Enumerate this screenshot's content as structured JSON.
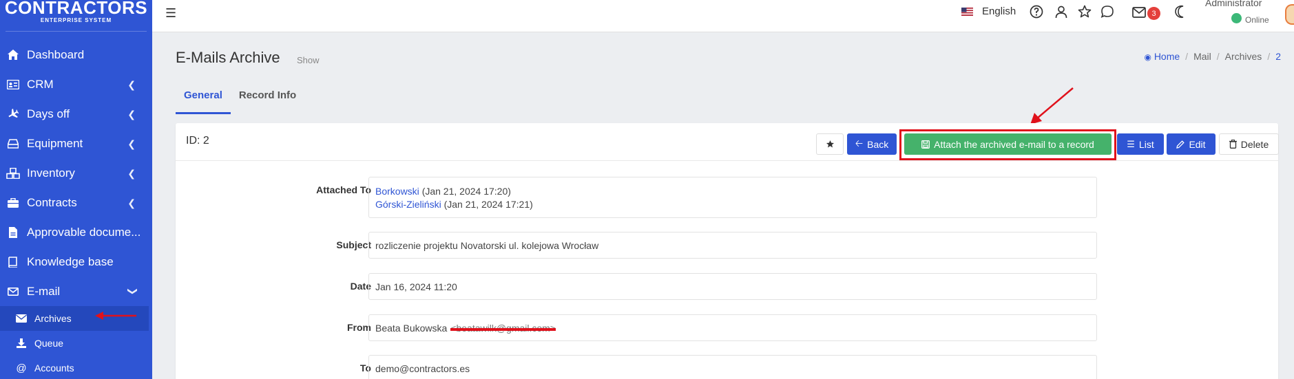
{
  "app": {
    "logo_title": "CONTRACTORS",
    "logo_sub": "ENTERPRISE SYSTEM"
  },
  "sidebar": {
    "items": [
      {
        "label": "Dashboard",
        "icon": "home-icon"
      },
      {
        "label": "CRM",
        "icon": "id-card-icon"
      },
      {
        "label": "Days off",
        "icon": "plane-icon"
      },
      {
        "label": "Equipment",
        "icon": "hdd-icon"
      },
      {
        "label": "Inventory",
        "icon": "boxes-icon"
      },
      {
        "label": "Contracts",
        "icon": "briefcase-icon"
      },
      {
        "label": "Approvable docume...",
        "icon": "file-icon"
      },
      {
        "label": "Knowledge base",
        "icon": "book-icon"
      },
      {
        "label": "E-mail",
        "icon": "envelope-icon"
      }
    ],
    "email_sub": [
      {
        "label": "Archives",
        "icon": "envelope-icon"
      },
      {
        "label": "Queue",
        "icon": "download-icon"
      },
      {
        "label": "Accounts",
        "icon": "at-icon"
      }
    ]
  },
  "topbar": {
    "language": "English",
    "mail_count": "3",
    "user_name": "Administrator",
    "status": "Online"
  },
  "page": {
    "title": "E-Mails Archive",
    "subtitle": "Show",
    "breadcrumb": [
      "Home",
      "Mail",
      "Archives",
      "2"
    ]
  },
  "tabs": [
    "General",
    "Record Info"
  ],
  "card": {
    "id_label": "ID: 2",
    "buttons": {
      "back": "Back",
      "attach": "Attach the archived e-mail to a record",
      "list": "List",
      "edit": "Edit",
      "delete": "Delete"
    }
  },
  "fields": {
    "attached_to_label": "Attached To",
    "attached": [
      {
        "name": "Borkowski",
        "date": "(Jan 21, 2024 17:20)"
      },
      {
        "name": "Górski-Zieliński",
        "date": "(Jan 21, 2024 17:21)"
      }
    ],
    "subject_label": "Subject",
    "subject": "rozliczenie projektu Novatorski ul. kolejowa Wrocław",
    "date_label": "Date",
    "date": "Jan 16, 2024 11:20",
    "from_label": "From",
    "from_name": "Beata Bukowska",
    "from_email": "<beatawilk@gmail.com>",
    "to_label": "To",
    "to": "demo@contractors.es"
  },
  "colors": {
    "sidebar": "#2f55d4",
    "primary": "#2f55d4",
    "success": "#45b26b",
    "annotation": "#e0111b"
  }
}
